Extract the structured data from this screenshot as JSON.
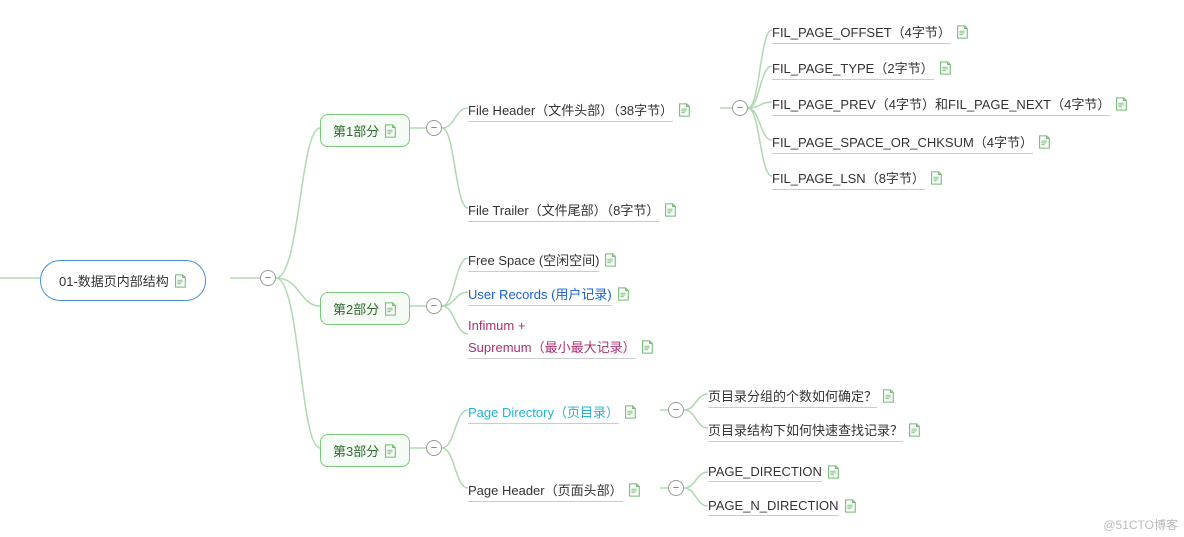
{
  "watermark": "@51CTO博客",
  "root": {
    "label": "01-数据页内部结构"
  },
  "sections": [
    {
      "label": "第1部分"
    },
    {
      "label": "第2部分"
    },
    {
      "label": "第3部分"
    }
  ],
  "s1": {
    "file_header": "File Header（文件头部）（38字节）",
    "file_trailer": "File Trailer（文件尾部）（8字节）",
    "fh_children": [
      "FIL_PAGE_OFFSET（4字节）",
      "FIL_PAGE_TYPE（2字节）",
      "FIL_PAGE_PREV（4字节）和FIL_PAGE_NEXT（4字节）",
      "FIL_PAGE_SPACE_OR_CHKSUM（4字节）",
      "FIL_PAGE_LSN（8字节）"
    ]
  },
  "s2": {
    "free_space": "Free Space (空闲空间)",
    "user_records": "User Records (用户记录)",
    "infimum_line1": "Infimum +",
    "infimum_line2": "Supremum（最小最大记录）"
  },
  "s3": {
    "page_directory": "Page Directory（页目录）",
    "page_header": "Page Header（页面头部）",
    "pd_children": [
      "页目录分组的个数如何确定？",
      "页目录结构下如何快速查找记录？"
    ],
    "ph_children": [
      "PAGE_DIRECTION",
      "PAGE_N_DIRECTION"
    ]
  },
  "toggle_symbol": "−"
}
